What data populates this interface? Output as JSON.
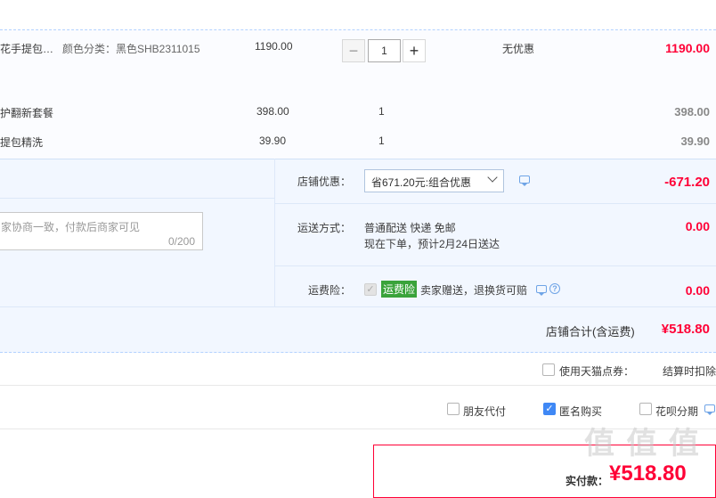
{
  "item1": {
    "name": "花手提包…",
    "variant": "颜色分类：黑色SHB2311015",
    "unit_price": "1190.00",
    "quantity": "1",
    "minus": "−",
    "plus": "+",
    "discount": "无优惠",
    "subtotal": "1190.00"
  },
  "item2": {
    "name": "护翻新套餐",
    "unit_price": "398.00",
    "quantity": "1",
    "subtotal": "398.00"
  },
  "item3": {
    "name": "提包精洗",
    "unit_price": "39.90",
    "quantity": "1",
    "subtotal": "39.90"
  },
  "message": {
    "placeholder": "家协商一致，付款后商家可见",
    "counter": "0/200"
  },
  "shop_discount": {
    "label": "店铺优惠：",
    "selected": "省671.20元:组合优惠",
    "amount": "-671.20"
  },
  "shipping": {
    "label": "运送方式：",
    "method": "普通配送 快递 免邮",
    "eta": "现在下单，预计2月24日送达",
    "amount": "0.00"
  },
  "insurance": {
    "label": "运费险：",
    "badge": "运费险",
    "desc": "卖家赠送，退换货可赔",
    "amount": "0.00"
  },
  "shop_total": {
    "label": "店铺合计(含运费)",
    "amount": "¥518.80"
  },
  "coupon": {
    "label": "使用天猫点券：",
    "note": "结算时扣除"
  },
  "options": {
    "friend_pay": "朋友代付",
    "anonymous": "匿名购买",
    "huabei": "花呗分期"
  },
  "pay": {
    "label": "实付款：",
    "amount": "¥518.80"
  },
  "watermark": "值 值 值"
}
